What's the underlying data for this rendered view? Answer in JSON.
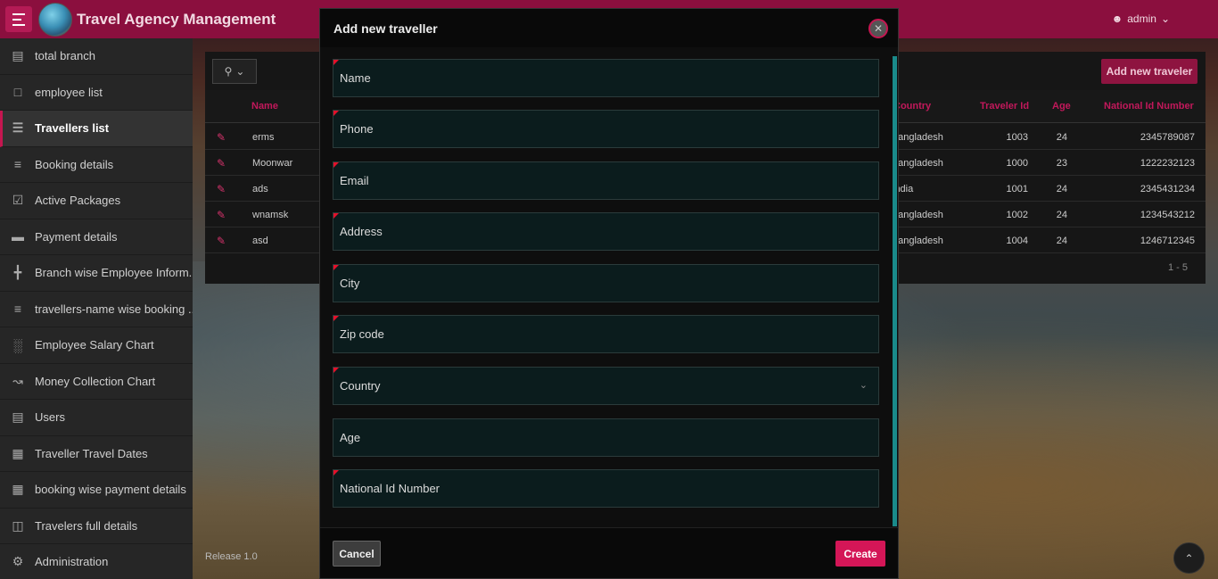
{
  "header": {
    "title": "Travel Agency Management",
    "user": "admin"
  },
  "sidebar": {
    "items": [
      {
        "label": "total branch",
        "icon": "clipboard-icon"
      },
      {
        "label": "employee list",
        "icon": "id-card-icon"
      },
      {
        "label": "Travellers list",
        "icon": "list-icon",
        "active": true
      },
      {
        "label": "Booking details",
        "icon": "align-center-icon"
      },
      {
        "label": "Active Packages",
        "icon": "checkbox-icon"
      },
      {
        "label": "Payment details",
        "icon": "credit-card-icon"
      },
      {
        "label": "Branch wise Employee Inform...",
        "icon": "hierarchy-icon"
      },
      {
        "label": "travellers-name wise booking ...",
        "icon": "align-center-icon"
      },
      {
        "label": "Employee Salary Chart",
        "icon": "bar-chart-icon"
      },
      {
        "label": "Money Collection Chart",
        "icon": "line-chart-icon"
      },
      {
        "label": "Users",
        "icon": "address-card-icon"
      },
      {
        "label": "Traveller Travel Dates",
        "icon": "calendar-icon"
      },
      {
        "label": "booking wise payment details",
        "icon": "table-icon"
      },
      {
        "label": "Travelers full details",
        "icon": "layout-icon"
      },
      {
        "label": "Administration",
        "icon": "user-wrench-icon"
      }
    ]
  },
  "report": {
    "add_button": "Add new traveler",
    "columns": {
      "name": "Name",
      "country": "Country",
      "traveler_id": "Traveler Id",
      "age": "Age",
      "national_id": "National Id Number"
    },
    "rows": [
      {
        "name": "erms",
        "country": "bangladesh",
        "traveler_id": "1003",
        "age": "24",
        "national_id": "2345789087"
      },
      {
        "name": "Moonwar",
        "country": "bangladesh",
        "traveler_id": "1000",
        "age": "23",
        "national_id": "1222232123"
      },
      {
        "name": "ads",
        "country": "india",
        "traveler_id": "1001",
        "age": "24",
        "national_id": "2345431234"
      },
      {
        "name": "wnamsk",
        "country": "bangladesh",
        "traveler_id": "1002",
        "age": "24",
        "national_id": "1234543212"
      },
      {
        "name": "asd",
        "country": "bangladesh",
        "traveler_id": "1004",
        "age": "24",
        "national_id": "1246712345"
      }
    ],
    "pagination": "1 - 5"
  },
  "footer": {
    "release": "Release 1.0"
  },
  "modal": {
    "title": "Add new traveller",
    "fields": [
      {
        "label": "Name",
        "required": true
      },
      {
        "label": "Phone",
        "required": true
      },
      {
        "label": "Email",
        "required": true
      },
      {
        "label": "Address",
        "required": true
      },
      {
        "label": "City",
        "required": true
      },
      {
        "label": "Zip code",
        "required": true
      },
      {
        "label": "Country",
        "required": true,
        "type": "select"
      },
      {
        "label": "Age",
        "required": false
      },
      {
        "label": "National Id Number",
        "required": true
      }
    ],
    "cancel": "Cancel",
    "create": "Create"
  },
  "colors": {
    "accent": "#c51650",
    "header": "#8b0f3e",
    "field_bg": "#0b1c1d",
    "scrollbar": "#1a8a8a"
  }
}
